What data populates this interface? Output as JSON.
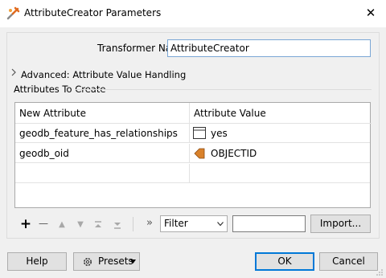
{
  "window": {
    "title": "AttributeCreator Parameters",
    "close_glyph": "✕"
  },
  "transformer": {
    "label": "Transformer Name:",
    "value": "AttributeCreator"
  },
  "advanced": {
    "label": "Advanced: Attribute Value Handling"
  },
  "group": {
    "label": "Attributes To Create"
  },
  "table": {
    "headers": [
      "New Attribute",
      "Attribute Value"
    ],
    "rows": [
      {
        "name": "geodb_feature_has_relationships",
        "value": "yes",
        "icon": "text-value-icon"
      },
      {
        "name": "geodb_oid",
        "value": "OBJECTID",
        "icon": "attribute-value-icon"
      }
    ]
  },
  "toolbar": {
    "add": "+",
    "remove": "—",
    "up": "▲",
    "down": "▼",
    "top": "⏫",
    "bottom": "⏬",
    "more": "»"
  },
  "filter": {
    "selected": "Filter",
    "text": ""
  },
  "buttons": {
    "import": "Import...",
    "help": "Help",
    "presets": "Presets",
    "ok": "OK",
    "cancel": "Cancel"
  },
  "colors": {
    "accent": "#0078d7",
    "attribute_icon": "#d9822b"
  }
}
